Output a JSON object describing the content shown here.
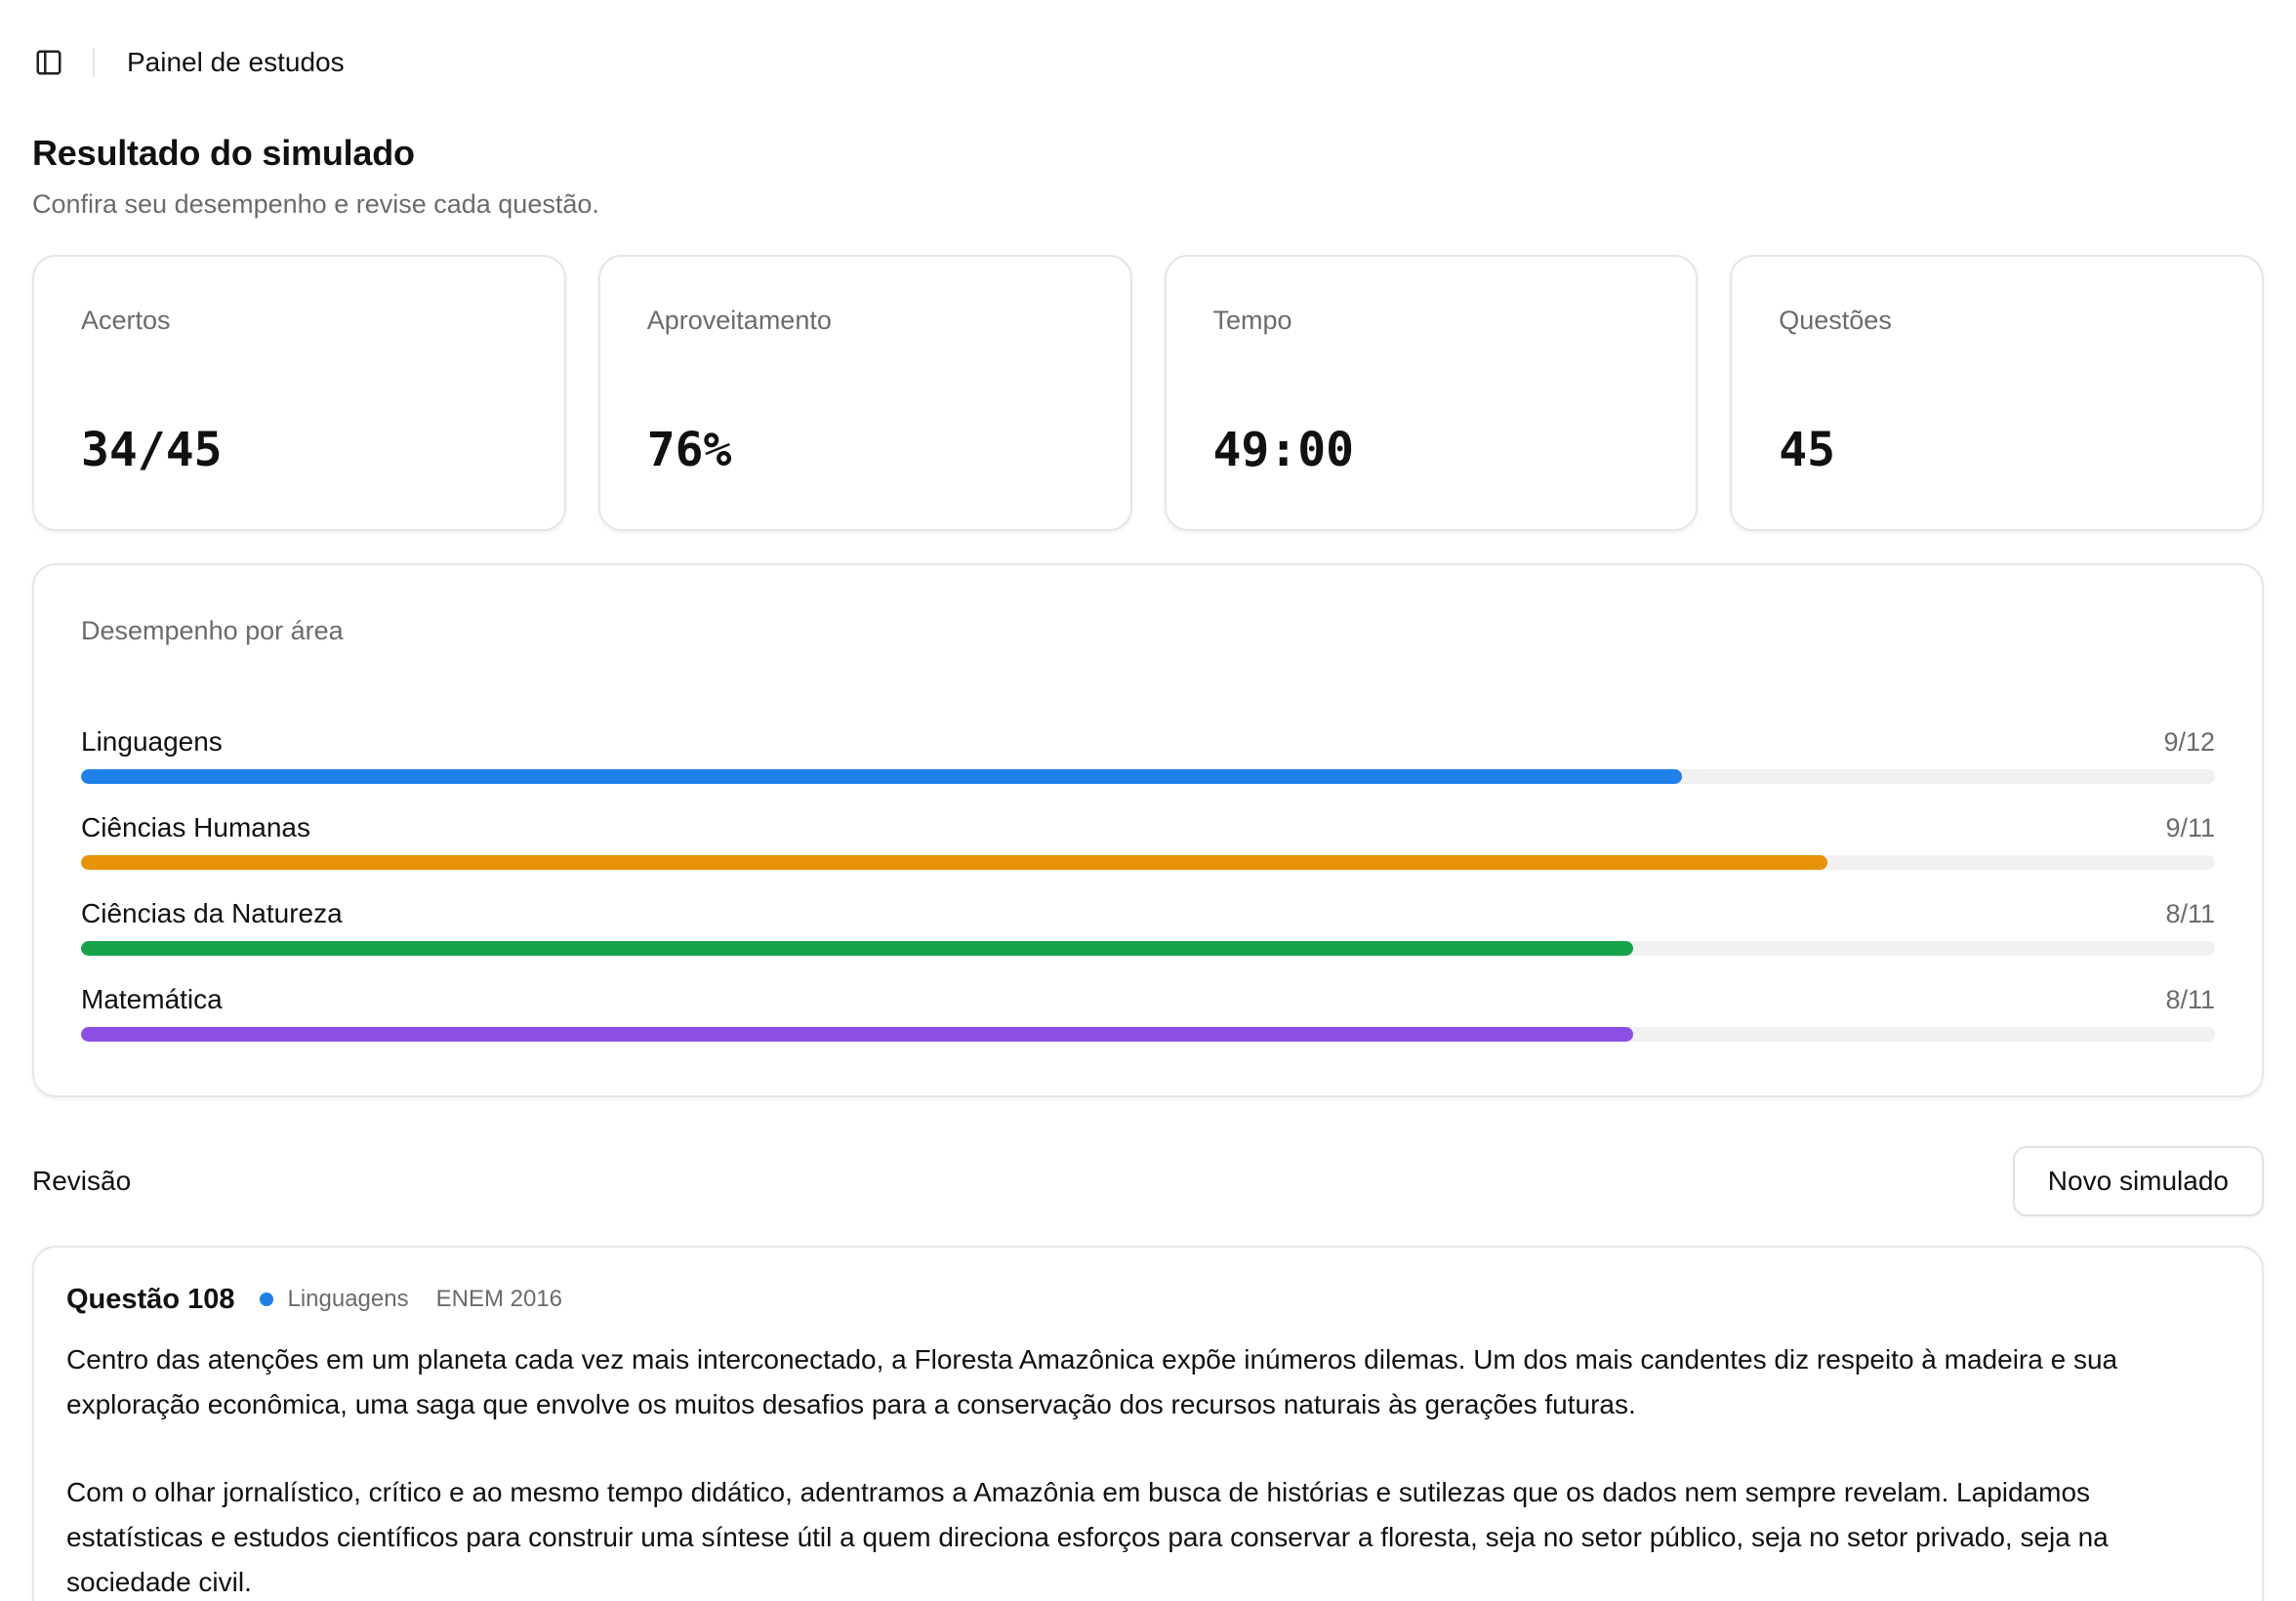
{
  "header": {
    "title": "Painel de estudos",
    "icon": "sidebar-toggle-icon"
  },
  "page": {
    "title": "Resultado do simulado",
    "subtitle": "Confira seu desempenho e revise cada questão."
  },
  "stats": [
    {
      "label": "Acertos",
      "value": "34/45"
    },
    {
      "label": "Aproveitamento",
      "value": "76%"
    },
    {
      "label": "Tempo",
      "value": "49:00"
    },
    {
      "label": "Questões",
      "value": "45"
    }
  ],
  "areas": {
    "title": "Desempenho por área",
    "items": [
      {
        "name": "Linguagens",
        "score": "9/12",
        "fraction": 0.75,
        "color": "#1f80e8"
      },
      {
        "name": "Ciências Humanas",
        "score": "9/11",
        "fraction": 0.8182,
        "color": "#e8930a"
      },
      {
        "name": "Ciências da Natureza",
        "score": "8/11",
        "fraction": 0.7273,
        "color": "#17a34a"
      },
      {
        "name": "Matemática",
        "score": "8/11",
        "fraction": 0.7273,
        "color": "#8b4fe6"
      }
    ]
  },
  "review": {
    "title": "Revisão",
    "new_button": "Novo simulado"
  },
  "question": {
    "number": "Questão 108",
    "area": "Linguagens",
    "area_color": "#1f80e8",
    "exam": "ENEM 2016",
    "paragraphs": [
      "Centro das atenções em um planeta cada vez mais interconectado, a Floresta Amazônica expõe inúmeros dilemas. Um dos mais candentes diz respeito à madeira e sua exploração econômica, uma saga que envolve os muitos desafios para a conservação dos recursos naturais às gerações futuras.",
      "Com o olhar jornalístico, crítico e ao mesmo tempo didático, adentramos a Amazônia em busca de histórias e sutilezas que os dados nem sempre revelam. Lapidamos estatísticas e estudos científicos para construir uma síntese útil a quem direciona esforços para conservar a floresta, seja no setor público, seja no setor privado, seja na sociedade civil."
    ]
  }
}
